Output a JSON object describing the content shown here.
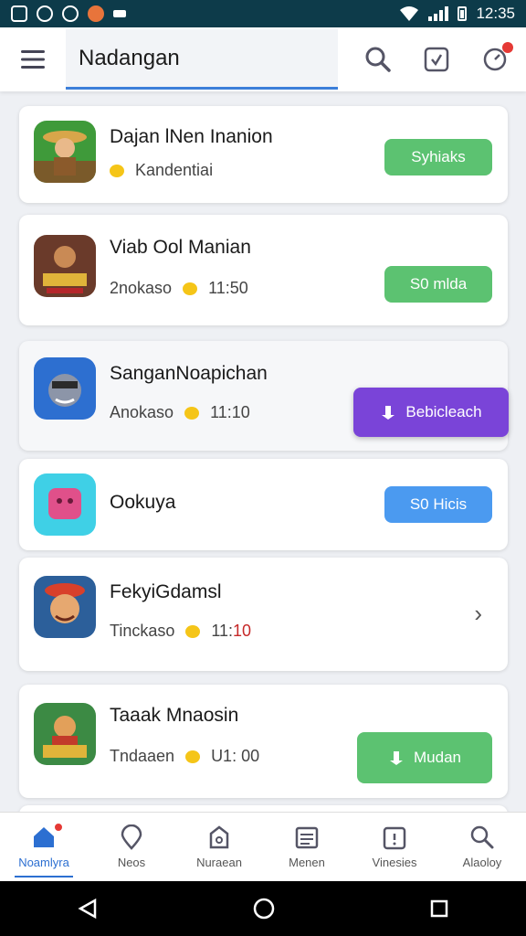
{
  "status_bar": {
    "time": "12:35",
    "left_icons": [
      "gallery-icon",
      "sync-icon",
      "settings-icon",
      "app-icon",
      "small-icon"
    ],
    "right_icons": [
      "wifi-icon",
      "signal-icon",
      "battery-icon"
    ]
  },
  "app_bar": {
    "search_text": "Nadangan",
    "icons": [
      "menu-icon",
      "search-icon",
      "check-square-icon",
      "notification-icon"
    ]
  },
  "apps": [
    {
      "title": "Dajan lNen Inanion",
      "subtitle": "Kandentiai",
      "button": "Syhiaks",
      "button_color": "#5cc271"
    },
    {
      "title": "Viab Ool Manian",
      "subtitle": "2nokaso",
      "time": "11:50",
      "button": "S0 mlda",
      "button_color": "#5cc271"
    },
    {
      "title": "SanganNoapichan",
      "subtitle": "Anokaso",
      "time": "11:10",
      "button": "Bebicleach",
      "button_color": "#7a44d8"
    },
    {
      "title": "Ookuya",
      "button": "S0 Hicis",
      "button_color": "#4b9af0"
    },
    {
      "title": "FekyiGdamsl",
      "subtitle": "Tinckaso",
      "time_prefix": "11:",
      "time_suffix": "10",
      "time_suffix_color": "#c62828"
    },
    {
      "title": "Taaak Mnaosin",
      "subtitle": "Tndaaen",
      "time": "U1: 00",
      "button": "Mudan",
      "button_color": "#5cc271"
    }
  ],
  "bottom_nav": [
    {
      "label": "Noamlyra",
      "icon": "home-icon",
      "active": true
    },
    {
      "label": "Neos",
      "icon": "location-pin-icon"
    },
    {
      "label": "Nuraean",
      "icon": "bag-icon"
    },
    {
      "label": "Menen",
      "icon": "list-icon"
    },
    {
      "label": "Vinesies",
      "icon": "calendar-icon"
    },
    {
      "label": "Alaoloy",
      "icon": "search-icon"
    }
  ],
  "system_nav": [
    "back-icon",
    "home-circle-icon",
    "recents-icon"
  ]
}
